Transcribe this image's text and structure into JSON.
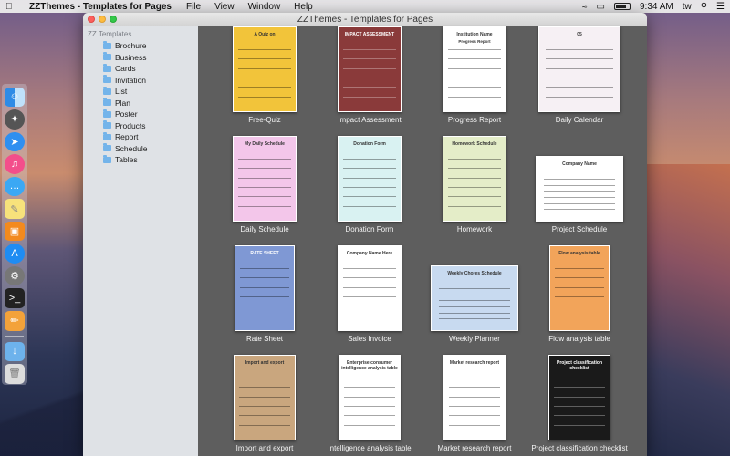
{
  "menubar": {
    "app_name": "ZZThemes - Templates for Pages",
    "menus": [
      "File",
      "View",
      "Window",
      "Help"
    ],
    "time": "9:34 AM",
    "user": "tw"
  },
  "window": {
    "title": "ZZThemes - Templates for Pages"
  },
  "sidebar": {
    "header": "ZZ Templates",
    "items": [
      "Brochure",
      "Business",
      "Cards",
      "Invitation",
      "List",
      "Plan",
      "Poster",
      "Products",
      "Report",
      "Schedule",
      "Tables"
    ]
  },
  "templates": [
    {
      "name": "Free-Quiz",
      "thumb_title": "A Quiz on",
      "bg": "#f2c43a"
    },
    {
      "name": "Impact Assessment",
      "thumb_title": "IMPACT ASSESSMENT",
      "bg": "#8a3a3a"
    },
    {
      "name": "Progress Report",
      "thumb_title": "Institution Name",
      "thumb_sub": "Progress Report",
      "bg": "#ffffff"
    },
    {
      "name": "Daily Calendar",
      "thumb_title": "05",
      "bg": "#f6f0f4"
    },
    {
      "name": "Daily Schedule",
      "thumb_title": "My Daily Schedule",
      "bg": "#f3c6ea"
    },
    {
      "name": "Donation Form",
      "thumb_title": "Donation Form",
      "bg": "#d9f2f2"
    },
    {
      "name": "Homework",
      "thumb_title": "Homework Schedule",
      "bg": "#e4edc8"
    },
    {
      "name": "Project Schedule",
      "thumb_title": "Company Name",
      "bg": "#ffffff"
    },
    {
      "name": "Rate Sheet",
      "thumb_title": "RATE SHEET",
      "bg": "#7f98d4"
    },
    {
      "name": "Sales Invoice",
      "thumb_title": "Company Name Here",
      "bg": "#ffffff"
    },
    {
      "name": "Weekly Planner",
      "thumb_title": "Weekly Chores Schedule",
      "bg": "#c8daf0"
    },
    {
      "name": "Flow analysis table",
      "thumb_title": "Flow analysis table",
      "bg": "#f2a45a"
    },
    {
      "name": "Import and export",
      "thumb_title": "Import and export",
      "bg": "#c9a67e"
    },
    {
      "name": "Intelligence analysis table",
      "thumb_title": "Enterprise consumer intelligence analysis table",
      "bg": "#ffffff"
    },
    {
      "name": "Market research report",
      "thumb_title": "Market research report",
      "bg": "#ffffff"
    },
    {
      "name": "Project classification checklist",
      "thumb_title": "Project classification checklist",
      "bg": "#1a1a1a"
    }
  ],
  "dock": {
    "icons": [
      "finder-icon",
      "launchpad-icon",
      "safari-icon",
      "itunes-icon",
      "messages-icon",
      "notes-icon",
      "ibooks-icon",
      "appstore-icon",
      "system-preferences-icon",
      "terminal-icon",
      "pages-icon",
      "downloads-folder-icon",
      "trash-icon"
    ]
  }
}
